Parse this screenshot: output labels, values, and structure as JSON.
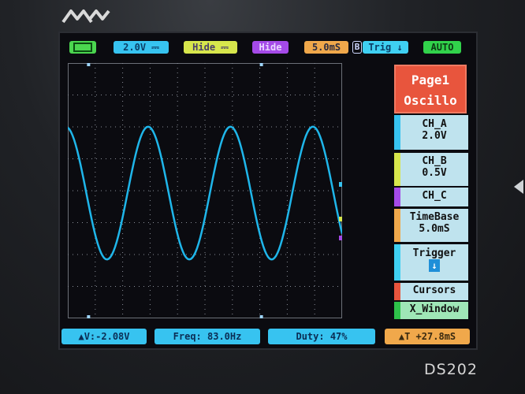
{
  "device": {
    "model": "DS202",
    "logo_icon": "mini-logo"
  },
  "top_bar": {
    "battery_icon": "battery-icon",
    "ch_a_scale": "2.0V",
    "ch_b_label": "Hide",
    "ch_c_label": "Hide",
    "timebase": "5.0mS",
    "trigger_source_badge": "B",
    "trigger_label": "Trig",
    "mode": "AUTO"
  },
  "readouts": {
    "delta_v": "▲V:-2.08V",
    "freq": "Freq: 83.0Hz",
    "duty": "Duty: 47%",
    "delta_t": "▲T +27.8mS"
  },
  "menu": {
    "page_title_line1": "Page1",
    "page_title_line2": "Oscillo",
    "ch_a": {
      "label": "CH_A",
      "value": "2.0V"
    },
    "ch_b": {
      "label": "CH_B",
      "value": "0.5V"
    },
    "ch_c": {
      "label": "CH_C"
    },
    "timebase": {
      "label": "TimeBase",
      "value": "5.0mS"
    },
    "trigger": {
      "label": "Trigger",
      "icon": "trigger-falling-edge-icon"
    },
    "cursors": {
      "label": "Cursors"
    },
    "x_window": {
      "label": "X_Window"
    }
  },
  "colors": {
    "trace": "#1fb6ea",
    "ch_a": "#37c3f0",
    "ch_b": "#d7e64c",
    "ch_c": "#a54ae8",
    "timebase": "#f0a84b",
    "trigger": "#3fd0f2",
    "mode": "#31d24b",
    "cursors": "#e8553d",
    "x_window": "#2ec24a",
    "page": "#e8553d"
  },
  "waveform": {
    "cycles_visible": 3.33,
    "amplitude_fraction": 0.52
  }
}
